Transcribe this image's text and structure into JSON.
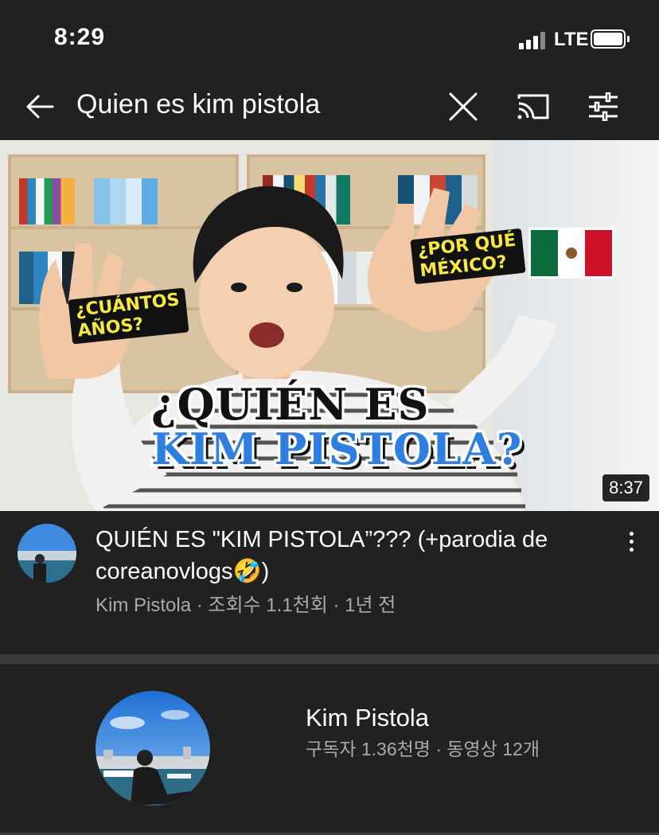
{
  "status_bar": {
    "time": "8:29",
    "network": "LTE",
    "icons": [
      "signal-icon",
      "battery-icon"
    ]
  },
  "search_bar": {
    "query": "Quien es kim pistola",
    "icons": [
      "back-arrow-icon",
      "close-icon",
      "cast-icon",
      "filter-sliders-icon"
    ]
  },
  "video": {
    "thumbnail": {
      "headline_line1": "¿QUIÉN ES",
      "headline_line2": "KIM PISTOLA?",
      "sticker_left_line1": "¿CUÁNTOS",
      "sticker_left_line2": "AÑOS?",
      "sticker_right_line1": "¿POR QUÉ",
      "sticker_right_line2": "MÉXICO?",
      "flag": "mexico-flag",
      "duration": "8:37"
    },
    "title": "QUIÉN ES \"KIM PISTOLA”??? (+parodia de coreanovlogs🤣)",
    "meta": "Kim Pistola · 조회수 1.1천회 · 1년 전",
    "menu_icon": "more-vert-icon"
  },
  "channel": {
    "name": "Kim Pistola",
    "meta": "구독자 1.36천명 · 동영상 12개"
  },
  "colors": {
    "background": "#212121",
    "secondary_text": "#aaaaaa",
    "divider": "#3a3a3a",
    "headline_blue": "#2f7fe0",
    "sticker_yellow": "#f7e83e"
  }
}
